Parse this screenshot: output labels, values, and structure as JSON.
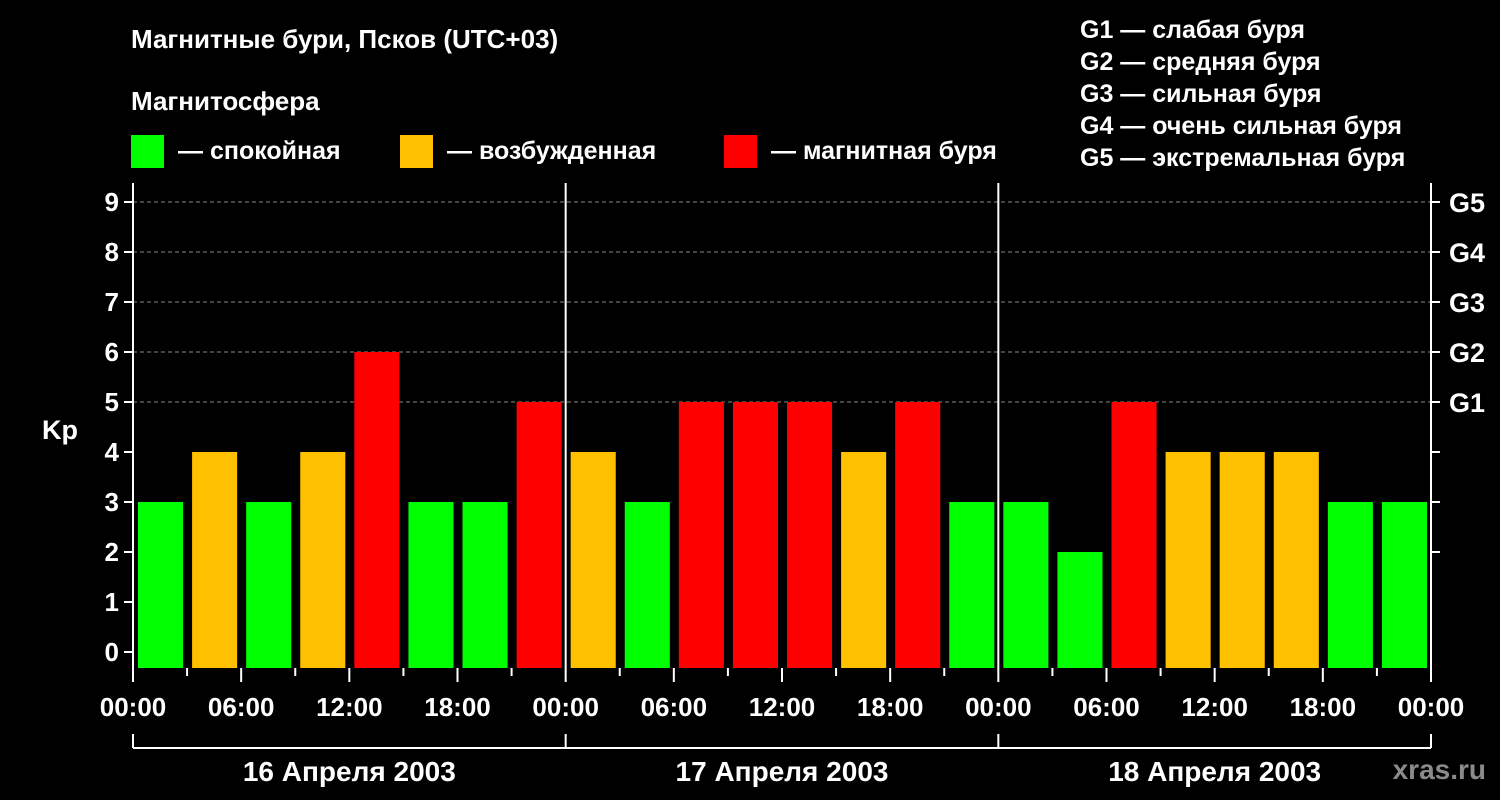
{
  "title": "Магнитные бури, Псков (UTC+03)",
  "legend": {
    "heading": "Магнитосфера",
    "items": [
      {
        "label": "— спокойная",
        "color": "#00ff00"
      },
      {
        "label": "— возбужденная",
        "color": "#ffc000"
      },
      {
        "label": "— магнитная буря",
        "color": "#ff0000"
      }
    ]
  },
  "storm_levels": [
    "G1 — слабая буря",
    "G2 — средняя буря",
    "G3 — сильная буря",
    "G4 — очень сильная буря",
    "G5 — экстремальная буря"
  ],
  "credit": "xras.ru",
  "chart_data": {
    "type": "bar",
    "ylabel": "Kp",
    "ylim": [
      0,
      9
    ],
    "yticks": [
      "0",
      "1",
      "2",
      "3",
      "4",
      "5",
      "6",
      "7",
      "8",
      "9"
    ],
    "right_axis_labels": [
      {
        "kp": 5,
        "label": "G1"
      },
      {
        "kp": 6,
        "label": "G2"
      },
      {
        "kp": 7,
        "label": "G3"
      },
      {
        "kp": 8,
        "label": "G4"
      },
      {
        "kp": 9,
        "label": "G5"
      }
    ],
    "x_tick_labels": [
      "00:00",
      "06:00",
      "12:00",
      "18:00",
      "00:00",
      "06:00",
      "12:00",
      "18:00",
      "00:00",
      "06:00",
      "12:00",
      "18:00",
      "00:00"
    ],
    "days": [
      "16 Апреля 2003",
      "17 Апреля 2003",
      "18 Апреля 2003"
    ],
    "grid": "horizontal dashed at Kp 5–9",
    "values": [
      3,
      4,
      3,
      4,
      6,
      3,
      3,
      5,
      4,
      3,
      5,
      5,
      5,
      4,
      5,
      3,
      3,
      2,
      5,
      4,
      4,
      4,
      3,
      3
    ],
    "status": [
      "quiet",
      "active",
      "quiet",
      "active",
      "storm",
      "quiet",
      "quiet",
      "storm",
      "active",
      "quiet",
      "storm",
      "storm",
      "storm",
      "active",
      "storm",
      "quiet",
      "quiet",
      "quiet",
      "storm",
      "active",
      "active",
      "active",
      "quiet",
      "quiet"
    ],
    "status_colors": {
      "quiet": "#00ff00",
      "active": "#ffc000",
      "storm": "#ff0000"
    }
  }
}
